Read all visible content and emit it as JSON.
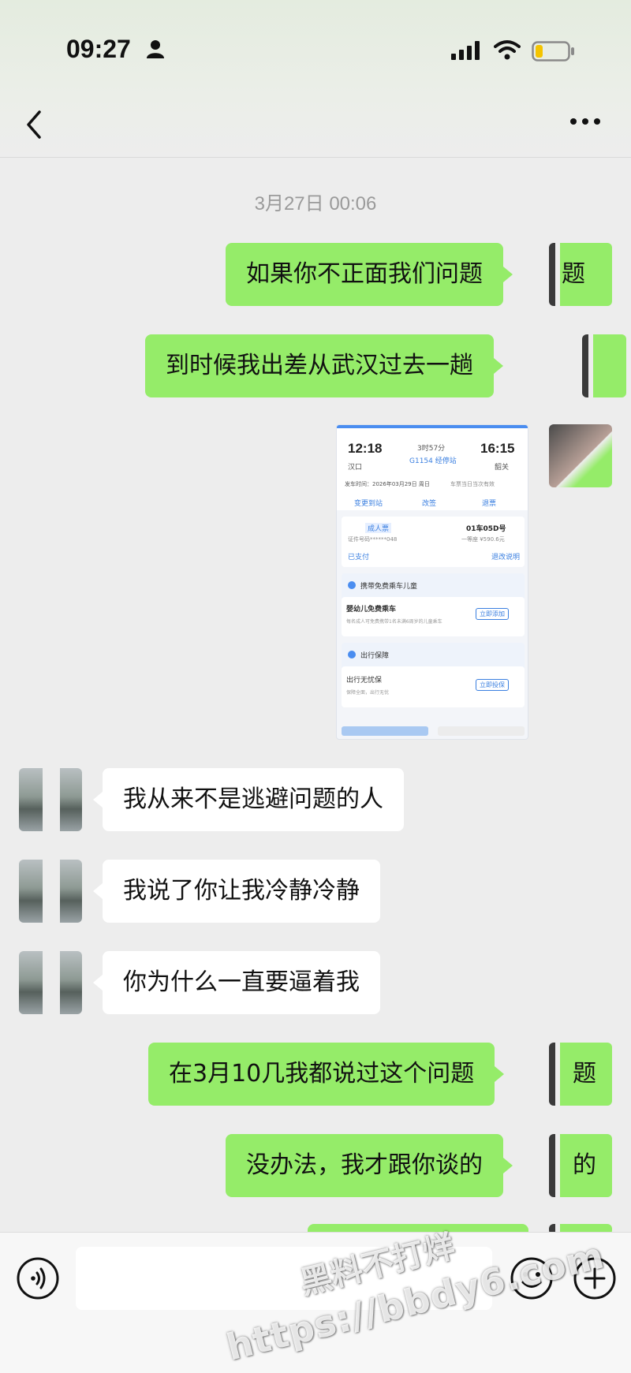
{
  "status_bar": {
    "time": "09:27",
    "icons": [
      "person-icon",
      "signal-icon",
      "wifi-icon",
      "battery-icon"
    ]
  },
  "nav": {
    "title": "",
    "icons": [
      "chevron-left-icon",
      "more-dots-icon"
    ]
  },
  "chat": {
    "timestamp": "3月27日 00:06",
    "messages": [
      {
        "side": "sent",
        "text": "如果你不正面我们问题",
        "avatar_text": "题"
      },
      {
        "side": "sent",
        "text": "到时候我出差从武汉过去一趟",
        "avatar_text": ""
      },
      {
        "side": "sent",
        "type": "image",
        "avatar_text": ""
      },
      {
        "side": "received",
        "text": "我从来不是逃避问题的人"
      },
      {
        "side": "received",
        "text": "我说了你让我冷静冷静"
      },
      {
        "side": "received",
        "text": "你为什么一直要逼着我"
      },
      {
        "side": "sent",
        "text": "在3月10几我都说过这个问题",
        "avatar_text": "题"
      },
      {
        "side": "sent",
        "text": "没办法，我才跟你谈的",
        "avatar_text": "的"
      }
    ]
  },
  "ticket": {
    "depart_time": "12:18",
    "arrive_time": "16:15",
    "depart_station": "汉口",
    "arrive_station": "韶关",
    "duration": "3时57分",
    "train": "G1154 经停站",
    "date_line": "发车时间：2026年03月29日 周日",
    "note": "车票当日当次有效",
    "actions": [
      "变更到站",
      "改签",
      "退票"
    ],
    "passenger_tag": "成人票",
    "seat": "01车05D号",
    "seat_class": "一等座 ¥590.6元",
    "id_masked": "证件号码******048",
    "paid": "已支付",
    "refund_rule": "退改说明",
    "child_section": "携带免费乘车儿童",
    "child_title": "婴幼儿免费乘车",
    "child_desc": "每名成人可免费携带1名未满6周岁的儿童乘车",
    "child_btn": "立即添加",
    "insurance_section": "出行保障",
    "insurance_title": "出行无忧保",
    "insurance_desc": "保障全面，出行无忧",
    "insurance_btn": "立即投保"
  },
  "input_bar": {
    "placeholder": "",
    "icons": [
      "voice-icon",
      "emoji-icon",
      "plus-icon"
    ]
  },
  "watermark": {
    "line1": "黑料不打烊",
    "line2": "https://bbdy6.com"
  }
}
